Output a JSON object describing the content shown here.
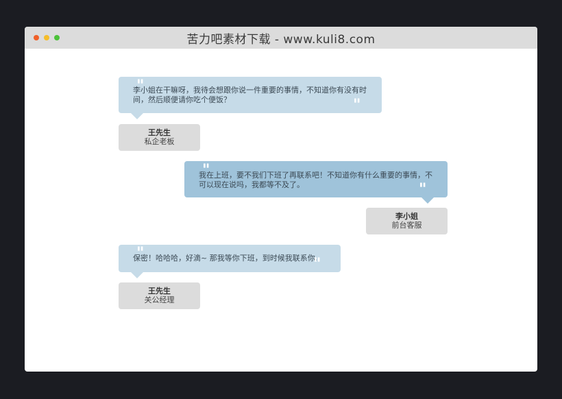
{
  "window": {
    "title": "苦力吧素材下载 - www.kuli8.com",
    "dots": [
      "#f0612a",
      "#f5bd2a",
      "#4cc23a"
    ]
  },
  "colors": {
    "bubble_light": "#c6dbe8",
    "bubble_dark": "#9fc3da",
    "card": "#dcdcdc"
  },
  "messages": [
    {
      "text": "李小姐在干嘛呀，我待会想跟你说一件重要的事情，不知道你有没有时间，然后顺便请你吃个便饭？",
      "speaker_name": "王先生",
      "speaker_role": "私企老板"
    },
    {
      "text": "我在上班，要不我们下班了再联系吧！不知道你有什么重要的事情，不可以现在说吗，我都等不及了。",
      "speaker_name": "李小姐",
      "speaker_role": "前台客服"
    },
    {
      "text": "保密！哈哈哈，好滴~ 那我等你下班，到时候我联系你.",
      "speaker_name": "王先生",
      "speaker_role": "关公经理"
    }
  ]
}
